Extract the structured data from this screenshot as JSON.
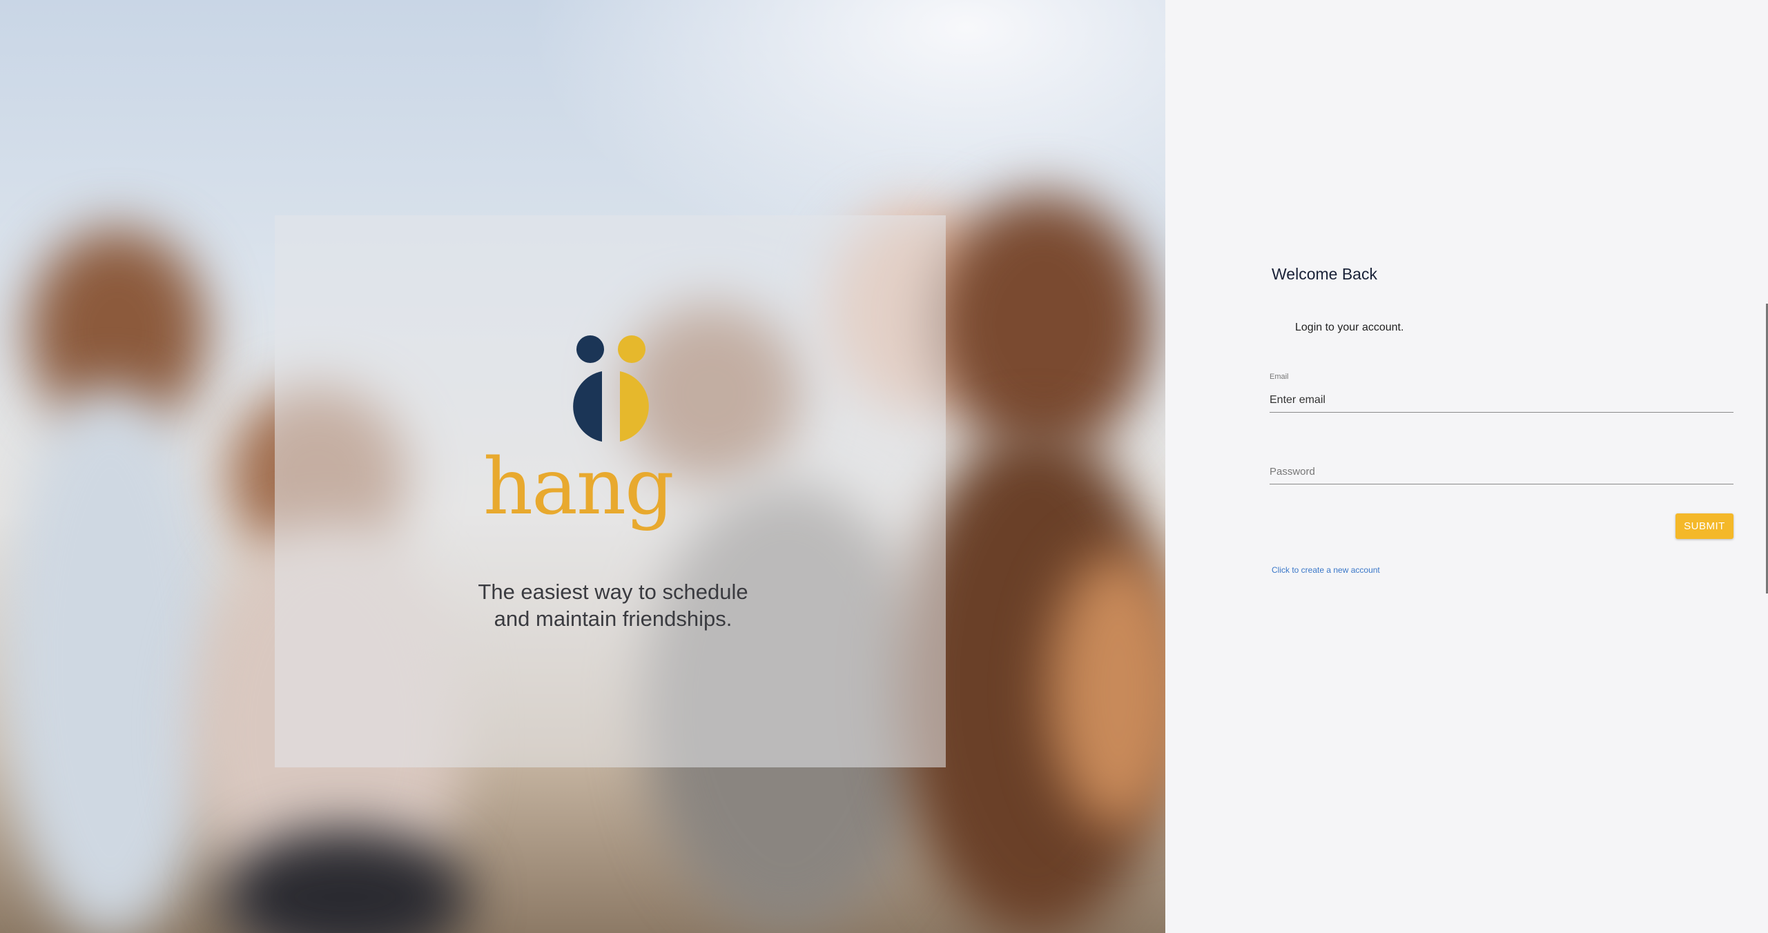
{
  "hero": {
    "brand_name": "hang",
    "tagline_line1": "The easiest way to schedule",
    "tagline_line2": "and maintain friendships.",
    "logo_colors": {
      "navy": "#1b3556",
      "gold": "#e6b82c"
    },
    "brand_color": "#e8a92e"
  },
  "login": {
    "title": "Welcome Back",
    "subtitle": "Login to your account.",
    "email": {
      "label": "Email",
      "placeholder": "Enter email",
      "value": ""
    },
    "password": {
      "placeholder": "Password",
      "value": ""
    },
    "submit_label": "SUBMIT",
    "create_account_link": "Click to create a new account",
    "accent_color": "#f4b829"
  }
}
